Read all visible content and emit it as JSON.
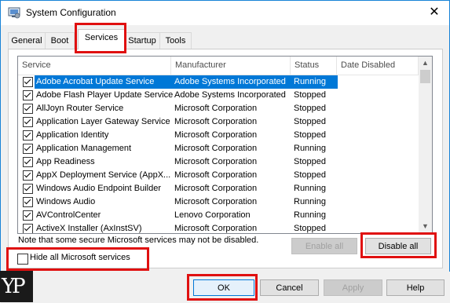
{
  "window": {
    "title": "System Configuration",
    "close_glyph": "✕"
  },
  "tabs": [
    {
      "label": "General"
    },
    {
      "label": "Boot"
    },
    {
      "label": "Services"
    },
    {
      "label": "Startup"
    },
    {
      "label": "Tools"
    }
  ],
  "active_tab": "Services",
  "columns": {
    "service": "Service",
    "manufacturer": "Manufacturer",
    "status": "Status",
    "date_disabled": "Date Disabled"
  },
  "services": [
    {
      "name": "Adobe Acrobat Update Service",
      "manufacturer": "Adobe Systems Incorporated",
      "status": "Running",
      "checked": true,
      "selected": true
    },
    {
      "name": "Adobe Flash Player Update Service",
      "manufacturer": "Adobe Systems Incorporated",
      "status": "Stopped",
      "checked": true
    },
    {
      "name": "AllJoyn Router Service",
      "manufacturer": "Microsoft Corporation",
      "status": "Stopped",
      "checked": true
    },
    {
      "name": "Application Layer Gateway Service",
      "manufacturer": "Microsoft Corporation",
      "status": "Stopped",
      "checked": true
    },
    {
      "name": "Application Identity",
      "manufacturer": "Microsoft Corporation",
      "status": "Stopped",
      "checked": true
    },
    {
      "name": "Application Management",
      "manufacturer": "Microsoft Corporation",
      "status": "Running",
      "checked": true
    },
    {
      "name": "App Readiness",
      "manufacturer": "Microsoft Corporation",
      "status": "Stopped",
      "checked": true
    },
    {
      "name": "AppX Deployment Service (AppX...",
      "manufacturer": "Microsoft Corporation",
      "status": "Stopped",
      "checked": true
    },
    {
      "name": "Windows Audio Endpoint Builder",
      "manufacturer": "Microsoft Corporation",
      "status": "Running",
      "checked": true
    },
    {
      "name": "Windows Audio",
      "manufacturer": "Microsoft Corporation",
      "status": "Running",
      "checked": true
    },
    {
      "name": "AVControlCenter",
      "manufacturer": "Lenovo Corporation",
      "status": "Running",
      "checked": true
    },
    {
      "name": "ActiveX Installer (AxInstSV)",
      "manufacturer": "Microsoft Corporation",
      "status": "Stopped",
      "checked": true
    }
  ],
  "scrollbar": {
    "up_glyph": "▲",
    "down_glyph": "▼"
  },
  "note": "Note that some secure Microsoft services may not be disabled.",
  "buttons": {
    "enable_all": "Enable all",
    "disable_all": "Disable all",
    "ok": "OK",
    "cancel": "Cancel",
    "apply": "Apply",
    "help": "Help"
  },
  "hide_microsoft": {
    "label": "Hide all Microsoft services",
    "checked": false
  },
  "logo": {
    "text": "YP"
  },
  "colors": {
    "highlight": "#e01010",
    "selection": "#0078d7"
  }
}
